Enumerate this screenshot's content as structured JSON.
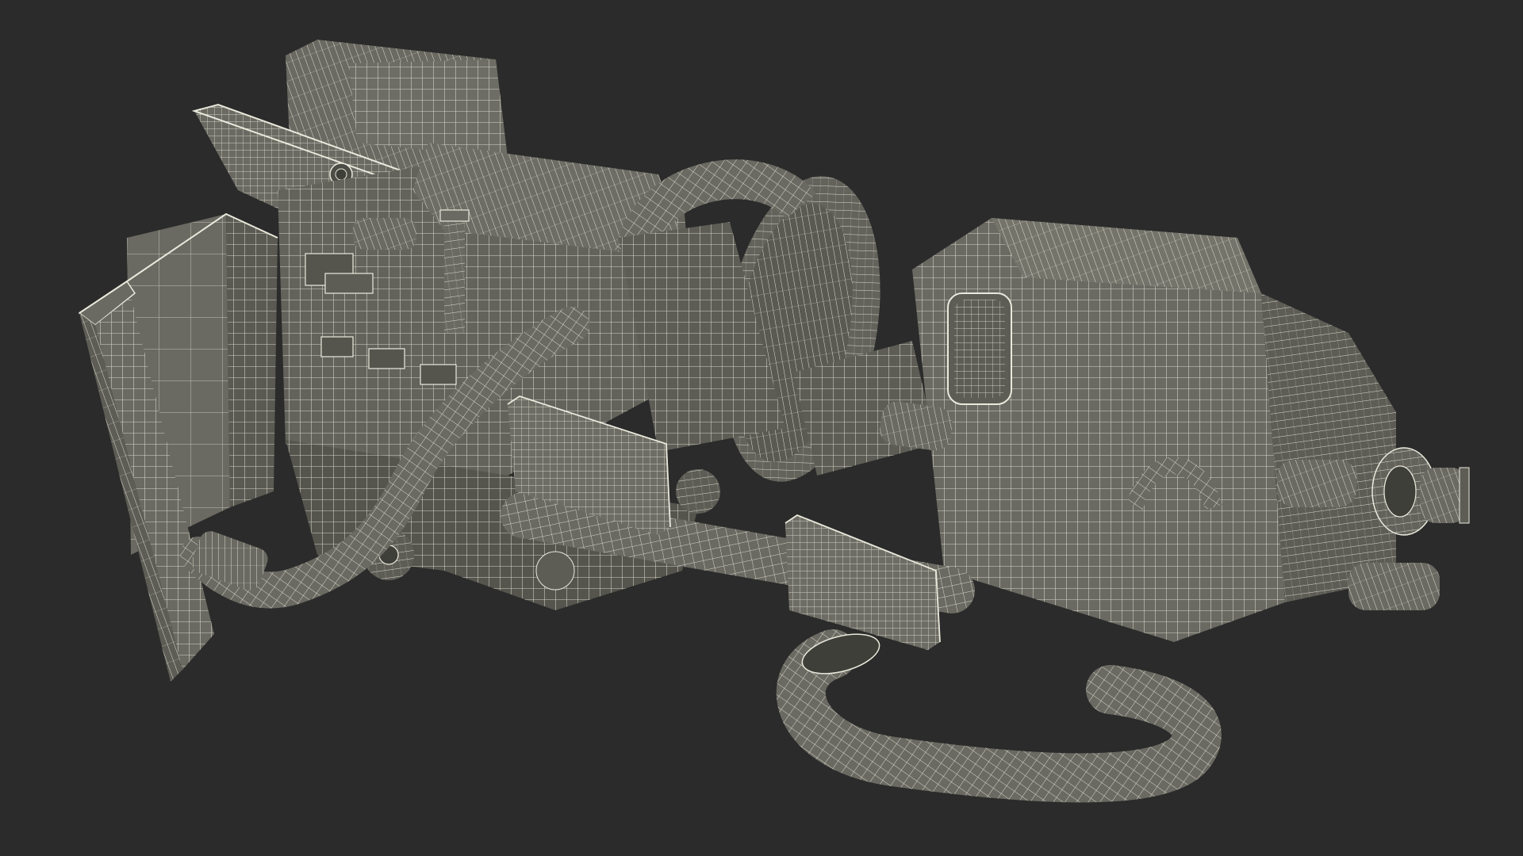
{
  "scene": {
    "background_color": "#2b2b2b",
    "mesh_fill_color": "#6a6a62",
    "mesh_shade_color": "#55554e",
    "mesh_dark_color": "#3f3f3a",
    "wire_color": "#e9e9dc",
    "subject": "wireframe-3d-mechanical-assembly"
  }
}
